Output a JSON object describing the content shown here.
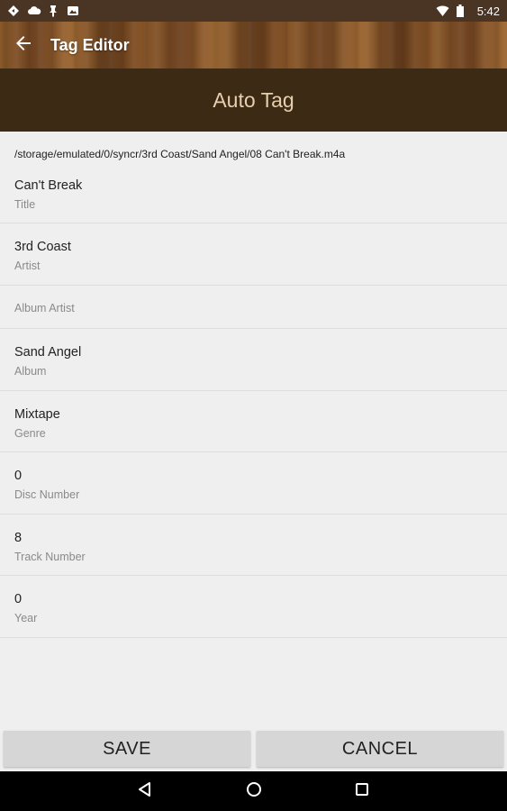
{
  "status_bar": {
    "time": "5:42",
    "left_icons": [
      "navigation-icon",
      "cloud-icon",
      "pin-icon",
      "photo-icon"
    ],
    "right_icons": [
      "wifi-icon",
      "battery-icon"
    ]
  },
  "toolbar": {
    "title": "Tag Editor",
    "back_icon": "back-arrow-icon"
  },
  "section": {
    "title": "Auto Tag"
  },
  "file_path": "/storage/emulated/0/syncr/3rd Coast/Sand Angel/08 Can't Break.m4a",
  "fields": [
    {
      "value": "Can't Break",
      "label": "Title"
    },
    {
      "value": "3rd Coast",
      "label": "Artist"
    },
    {
      "value": "",
      "label": "Album Artist"
    },
    {
      "value": "Sand Angel",
      "label": "Album"
    },
    {
      "value": "Mixtape",
      "label": "Genre"
    },
    {
      "value": "0",
      "label": "Disc Number"
    },
    {
      "value": "8",
      "label": "Track Number"
    },
    {
      "value": "0",
      "label": "Year"
    }
  ],
  "buttons": {
    "save": "SAVE",
    "cancel": "CANCEL"
  },
  "nav_bar": {
    "icons": [
      "back-triangle-icon",
      "home-circle-icon",
      "recents-square-icon"
    ]
  },
  "colors": {
    "status_bar": "#4a3424",
    "header_bg": "#3c2a14",
    "header_text": "#e7cfae",
    "content_bg": "#efefef",
    "button_bg": "#d6d6d6"
  }
}
